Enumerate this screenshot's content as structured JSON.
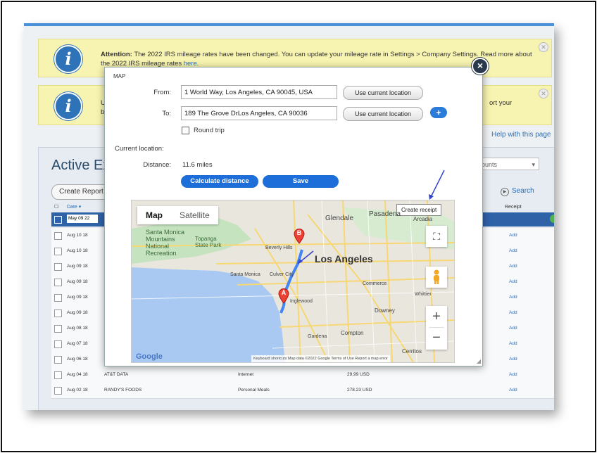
{
  "alert1": {
    "prefix": "Attention:",
    "text": "The 2022 IRS mileage rates have been changed. You can update your mileage rate in Settings > Company Settings. Read more about the 2022 IRS mileage rates",
    "link": "here."
  },
  "alert2": {
    "text_left": "Use t",
    "text_left2": "busin",
    "text_right": "ort your"
  },
  "help_link": "Help with this page",
  "panel": {
    "title": "Active Ex",
    "filter_value": "ccounts",
    "create_button": "Create Report",
    "search": "Search"
  },
  "table": {
    "headers": {
      "date": "Date",
      "receipt": "Receipt"
    },
    "selected_date": "May 09 22",
    "rows": [
      {
        "date": "Aug 10 18",
        "merchant": "",
        "category": "",
        "amount": "",
        "action": "Add"
      },
      {
        "date": "Aug 10 18",
        "merchant": "",
        "category": "",
        "amount": "",
        "action": "Add"
      },
      {
        "date": "Aug 09 18",
        "merchant": "",
        "category": "",
        "amount": "",
        "action": "Add"
      },
      {
        "date": "Aug 09 18",
        "merchant": "",
        "category": "",
        "amount": "",
        "action": "Add"
      },
      {
        "date": "Aug 09 18",
        "merchant": "",
        "category": "",
        "amount": "",
        "action": "Add"
      },
      {
        "date": "Aug 09 18",
        "merchant": "",
        "category": "",
        "amount": "",
        "action": "Add"
      },
      {
        "date": "Aug 08 18",
        "merchant": "",
        "category": "",
        "amount": "",
        "action": "Add"
      },
      {
        "date": "Aug 07 18",
        "merchant": "",
        "category": "",
        "amount": "",
        "action": "Add"
      },
      {
        "date": "Aug 06 18",
        "merchant": "",
        "category": "",
        "amount": "",
        "action": "Add"
      },
      {
        "date": "Aug 04 18",
        "merchant": "AT&T DATA",
        "category": "Internet",
        "amount": "29.99 USD",
        "action": "Add"
      },
      {
        "date": "Aug 02 18",
        "merchant": "RANDY'S FOODS",
        "category": "Personal Meals",
        "amount": "278.23 USD",
        "action": "Add"
      }
    ]
  },
  "modal": {
    "title": "MAP",
    "from_label": "From:",
    "from_value": "1 World Way, Los Angeles, CA 90045, USA",
    "to_label": "To:",
    "to_value": "189 The Grove DrLos Angeles, CA 90036",
    "use_location": "Use current location",
    "plus": "+",
    "round_trip": "Round trip",
    "current_location_label": "Current location:",
    "distance_label": "Distance:",
    "distance_value": "11.6 miles",
    "calculate": "Calculate distance",
    "save": "Save",
    "close": "×"
  },
  "map": {
    "tab_map": "Map",
    "tab_satellite": "Satellite",
    "create_receipt": "Create receipt",
    "city": "Los Angeles",
    "labels": {
      "glendale": "Glendale",
      "pasadena": "Pasadena",
      "arcadia": "Arcadia",
      "santa_monica_mtns": "Santa Monica",
      "mountains": "Mountains",
      "national": "National",
      "recreation": "Recreation",
      "topanga": "Topanga",
      "state_park": "State Park",
      "beverly_hills": "Beverly Hills",
      "santa_monica": "Santa Monica",
      "culver_city": "Culver City",
      "commerce": "Commerce",
      "whittier": "Whittier",
      "inglewood": "Inglewood",
      "downey": "Downey",
      "compton": "Compton",
      "gardena": "Gardena",
      "cerritos": "Cerritos"
    },
    "marker_a": "A",
    "marker_b": "B",
    "zoom_in": "+",
    "zoom_out": "−",
    "google": "Google",
    "footer": "Keyboard shortcuts   Map data ©2022 Google   Terms of Use   Report a map error",
    "colors": {
      "water": "#a9c9f2",
      "land": "#e9e6de",
      "park": "#c5e3bf",
      "route": "#4285f4",
      "marker": "#ea4335"
    }
  }
}
